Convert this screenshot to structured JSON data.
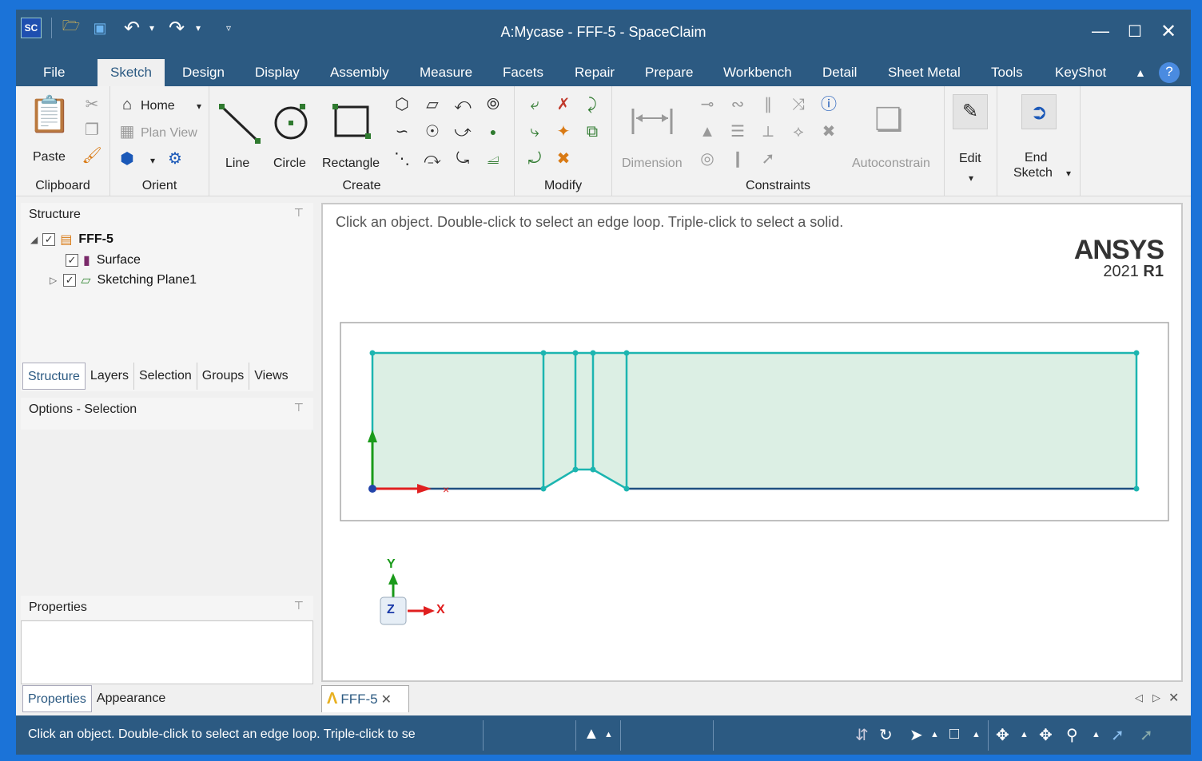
{
  "window": {
    "title": "A:Mycase - FFF-5 - SpaceClaim"
  },
  "quick_access": {
    "app_logo": "SC"
  },
  "menu_tabs": [
    "File",
    "Sketch",
    "Design",
    "Display",
    "Assembly",
    "Measure",
    "Facets",
    "Repair",
    "Prepare",
    "Workbench",
    "Detail",
    "Sheet Metal",
    "Tools",
    "KeyShot"
  ],
  "ribbon": {
    "clipboard": {
      "paste": "Paste",
      "label": "Clipboard"
    },
    "orient": {
      "home": "Home",
      "plan_view": "Plan View",
      "label": "Orient"
    },
    "create": {
      "line": "Line",
      "circle": "Circle",
      "rectangle": "Rectangle",
      "label": "Create"
    },
    "modify": {
      "label": "Modify"
    },
    "constraints": {
      "dimension": "Dimension",
      "autoconstrain": "Autoconstrain",
      "label": "Constraints"
    },
    "edit": {
      "label": "Edit"
    },
    "end_sketch": {
      "line1": "End",
      "line2": "Sketch"
    }
  },
  "structure": {
    "header": "Structure",
    "root": "FFF-5",
    "children": [
      "Surface",
      "Sketching Plane1"
    ],
    "tabs": [
      "Structure",
      "Layers",
      "Selection",
      "Groups",
      "Views"
    ]
  },
  "options": {
    "header": "Options - Selection"
  },
  "properties": {
    "header": "Properties",
    "tabs": [
      "Properties",
      "Appearance"
    ]
  },
  "viewport": {
    "hint": "Click an object. Double-click to select an edge loop. Triple-click to select a solid.",
    "brand": "ANSYS",
    "version_year": "2021",
    "version_release": "R1",
    "axis_y": "Y",
    "axis_z": "Z",
    "axis_x": "X"
  },
  "document_tab": {
    "label": "FFF-5"
  },
  "status": {
    "text": "Click an object. Double-click to select an edge loop. Triple-click to se"
  },
  "colors": {
    "title_bar": "#2c5a82",
    "sketch_line": "#1cb5b0",
    "sketch_fill": "#dcefe4",
    "axis_x": "#e02020",
    "axis_y": "#1a9a1a"
  }
}
